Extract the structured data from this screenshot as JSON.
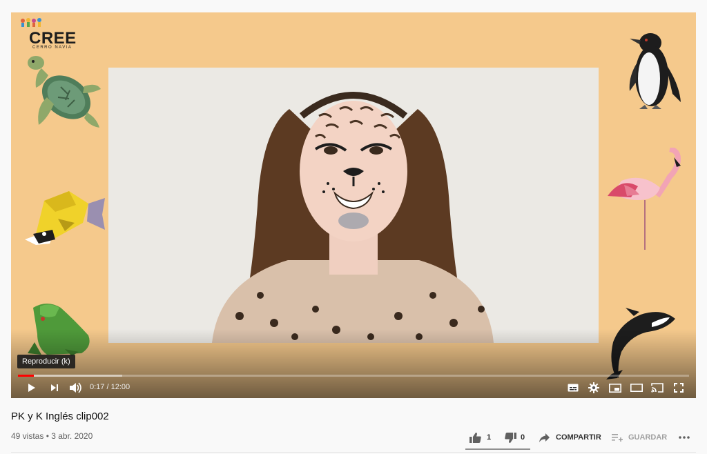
{
  "branding": {
    "logo_title": "CREE",
    "logo_subtitle": "CERRO NAVIA"
  },
  "player": {
    "tooltip": "Reproducir (k)",
    "time_display": "0:17 / 12:00",
    "progress_played": 0.024,
    "progress_buffered": 0.155,
    "accent_color": "#ff0000",
    "background_color": "#f5c98c",
    "icons": [
      "play-icon",
      "next-icon",
      "volume-icon",
      "subtitles-icon",
      "settings-icon",
      "miniplayer-icon",
      "theater-icon",
      "cast-icon",
      "fullscreen-icon"
    ]
  },
  "video": {
    "title": "PK y K Inglés clip002",
    "meta": "49 vistas • 3 abr. 2020"
  },
  "actions": {
    "likes": "1",
    "dislikes": "0",
    "share_label": "COMPARTIR",
    "save_label": "GUARDAR"
  }
}
